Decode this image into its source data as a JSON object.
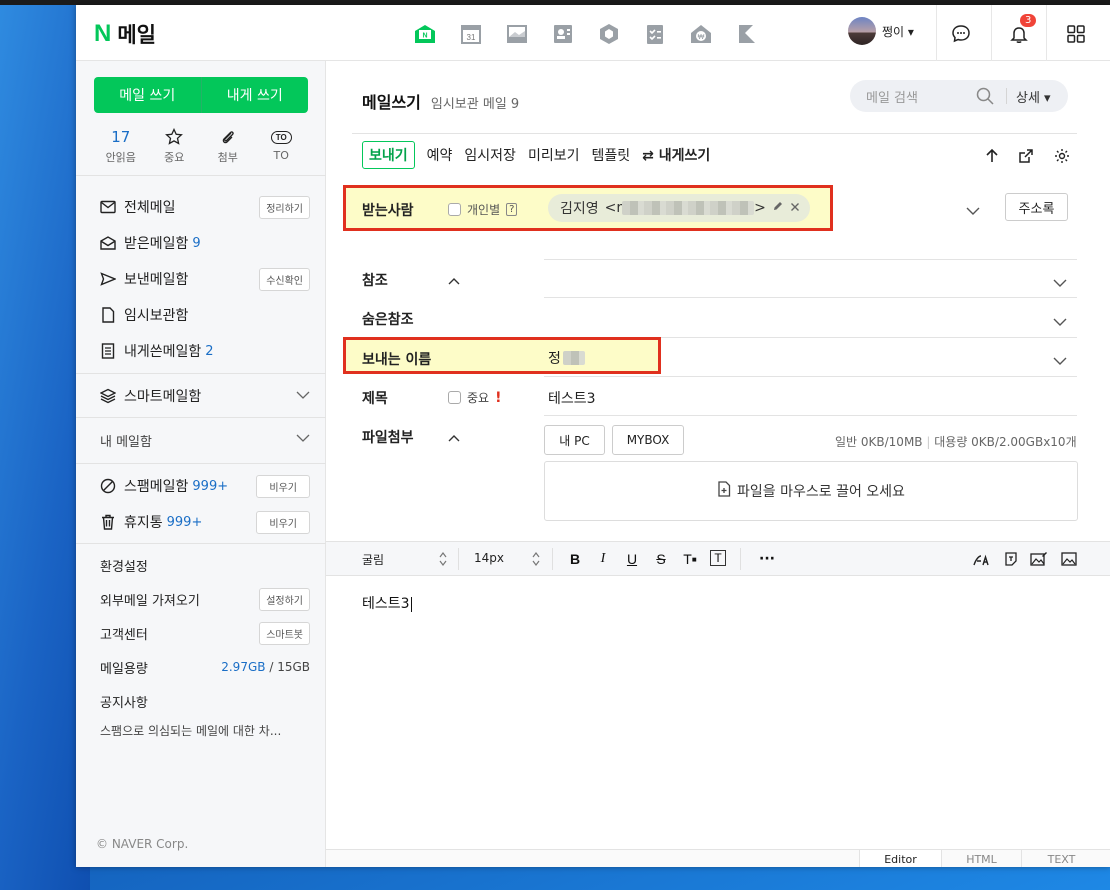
{
  "header": {
    "logo_n": "N",
    "logo_text": "메일",
    "apps": [
      "mail-app-icon",
      "calendar-icon",
      "photo-icon",
      "contacts-icon",
      "box-icon",
      "memo-icon",
      "pay-icon",
      "shortcut-icon"
    ],
    "calendar_day": "31",
    "pay_symbol": "₩",
    "user_name": "쩡이 ▾",
    "notification_count": "3"
  },
  "sidebar": {
    "compose_label": "메일 쓰기",
    "self_label": "내게 쓰기",
    "quick": [
      {
        "top": "17",
        "label": "안읽음"
      },
      {
        "label": "중요"
      },
      {
        "label": "첨부"
      },
      {
        "top": "TO",
        "label": "TO"
      }
    ],
    "folders": [
      {
        "label": "전체메일",
        "button": "정리하기"
      },
      {
        "label": "받은메일함",
        "count": "9"
      },
      {
        "label": "보낸메일함",
        "button": "수신확인"
      },
      {
        "label": "임시보관함"
      },
      {
        "label": "내게쓴메일함",
        "count": "2"
      }
    ],
    "smart_label": "스마트메일함",
    "my_mail_label": "내 메일함",
    "spam": {
      "label": "스팸메일함",
      "count": "999+",
      "button": "비우기"
    },
    "trash": {
      "label": "휴지통",
      "count": "999+",
      "button": "비우기"
    },
    "settings": "환경설정",
    "external": {
      "label": "외부메일 가져오기",
      "button": "설정하기"
    },
    "support": {
      "label": "고객센터",
      "button": "스마트봇"
    },
    "storage": {
      "label": "메일용량",
      "used": "2.97GB",
      "sep": "/",
      "total": "15GB"
    },
    "notice_title": "공지사항",
    "notice_text": "스팸으로 의심되는 메일에 대한 차...",
    "copyright": "© NAVER Corp."
  },
  "main": {
    "title": "메일쓰기",
    "subtitle": "임시보관 메일 9",
    "search_placeholder": "메일 검색",
    "search_detail": "상세 ▾",
    "toolbar": {
      "send": "보내기",
      "reserve": "예약",
      "draft": "임시저장",
      "preview": "미리보기",
      "template": "템플릿",
      "self": "⇄ 내게쓰기"
    },
    "to": {
      "label": "받는사람",
      "individual": "개인별",
      "help": "?",
      "recipient_name": "김지영",
      "recipient_open": "<r",
      "recipient_close": ">",
      "address_book": "주소록"
    },
    "cc_label": "참조",
    "bcc_label": "숨은참조",
    "sender": {
      "label": "보내는 이름",
      "value": "정"
    },
    "subject": {
      "label": "제목",
      "important": "중요",
      "mark": "!",
      "value": "테스트3"
    },
    "attach": {
      "label": "파일첨부",
      "pc": "내 PC",
      "mybox": "MYBOX",
      "quota_normal": "일반 0KB/10MB",
      "quota_sep": "|",
      "quota_large": "대용량 0KB/2.00GBx10개",
      "drop_text": "파일을 마우스로 끌어 오세요"
    },
    "editor": {
      "font": "굴림",
      "size": "14px",
      "body": "테스트3",
      "modes": [
        "Editor",
        "HTML",
        "TEXT"
      ]
    }
  },
  "colors": {
    "brand": "#03c75a",
    "highlight_fill": "#fdfcc8",
    "highlight_border": "#e0301e",
    "link": "#1a6ec6"
  }
}
